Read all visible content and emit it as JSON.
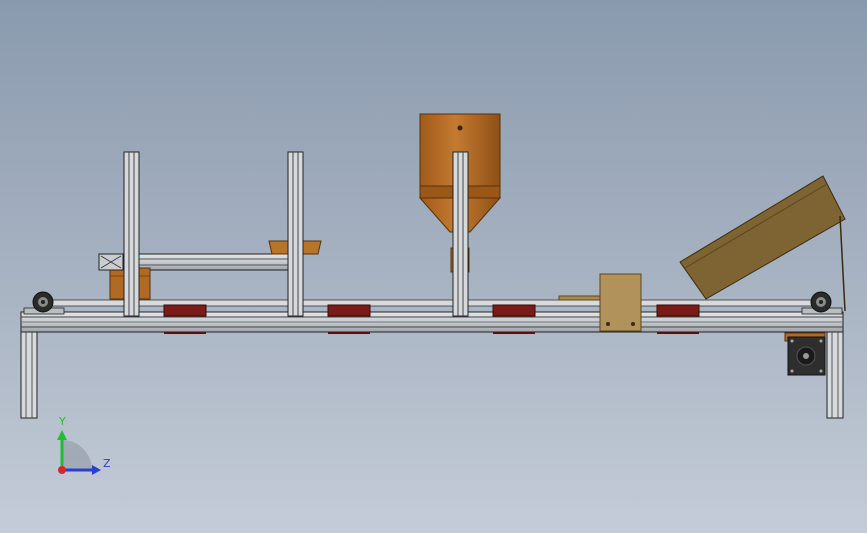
{
  "viewport": {
    "background_top": "#8a9aae",
    "background_bottom": "#c4ccd8",
    "model": "conveyor-filling-machine",
    "view": "front",
    "display_style": "shaded-with-edges"
  },
  "triad": {
    "y_label": "Y",
    "z_label": "Z",
    "y_color": "#1fbf2f",
    "z_color": "#2a3fd6",
    "x_color": "#d6262a"
  },
  "colors": {
    "aluminum": "#d3d7dc",
    "aluminum_edge": "#2a2a2a",
    "bronze": "#b06a24",
    "bronze_dark": "#7a4410",
    "chute": "#7d6432",
    "bracket": "#b1925a",
    "pad": "#7a1b18",
    "motor": "#2e2e2e"
  }
}
